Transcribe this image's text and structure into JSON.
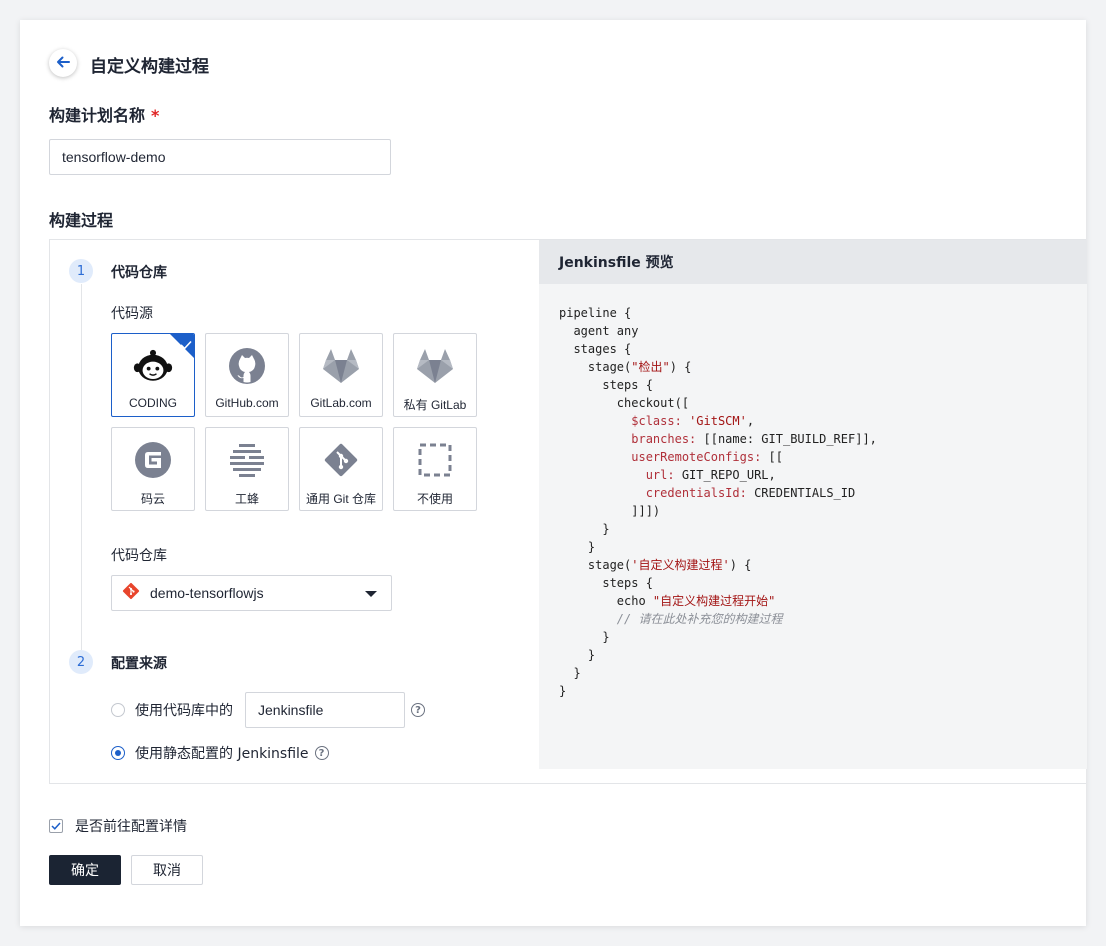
{
  "header": {
    "title": "自定义构建过程"
  },
  "plan_name": {
    "label": "构建计划名称",
    "required_mark": "*",
    "value": "tensorflow-demo"
  },
  "process": {
    "label": "构建过程"
  },
  "step1": {
    "number": "1",
    "title": "代码仓库",
    "source_label": "代码源",
    "sources": [
      {
        "name": "CODING",
        "icon": "coding-icon",
        "selected": true
      },
      {
        "name": "GitHub.com",
        "icon": "github-icon"
      },
      {
        "name": "GitLab.com",
        "icon": "gitlab-icon"
      },
      {
        "name": "私有 GitLab",
        "icon": "gitlab-icon"
      },
      {
        "name": "码云",
        "icon": "gitee-icon"
      },
      {
        "name": "工蜂",
        "icon": "gongfeng-icon"
      },
      {
        "name": "通用 Git 仓库",
        "icon": "git-icon"
      },
      {
        "name": "不使用",
        "icon": "dashed-box-icon"
      }
    ],
    "repo_label": "代码仓库",
    "repo_value": "demo-tensorflowjs"
  },
  "step2": {
    "number": "2",
    "title": "配置来源",
    "option1": {
      "label": "使用代码库中的",
      "input_value": "Jenkinsfile",
      "selected": false
    },
    "option2": {
      "label": "使用静态配置的 Jenkinsfile",
      "selected": true
    },
    "help_glyph": "?"
  },
  "preview": {
    "title": "Jenkinsfile 预览",
    "lines": [
      [
        [
          "t",
          "pipeline {"
        ]
      ],
      [
        [
          "t",
          "  agent any"
        ]
      ],
      [
        [
          "t",
          "  stages {"
        ]
      ],
      [
        [
          "t",
          "    stage("
        ],
        [
          "s",
          "\"检出\""
        ],
        [
          "t",
          ") {"
        ]
      ],
      [
        [
          "t",
          "      steps {"
        ]
      ],
      [
        [
          "t",
          "        checkout(["
        ]
      ],
      [
        [
          "t",
          "          "
        ],
        [
          "k",
          "$class:"
        ],
        [
          "t",
          " "
        ],
        [
          "s",
          "'GitSCM'"
        ],
        [
          "t",
          ","
        ]
      ],
      [
        [
          "t",
          "          "
        ],
        [
          "k",
          "branches:"
        ],
        [
          "t",
          " [[name: GIT_BUILD_REF]],"
        ]
      ],
      [
        [
          "t",
          "          "
        ],
        [
          "k",
          "userRemoteConfigs:"
        ],
        [
          "t",
          " [["
        ]
      ],
      [
        [
          "t",
          "            "
        ],
        [
          "k",
          "url:"
        ],
        [
          "t",
          " GIT_REPO_URL,"
        ]
      ],
      [
        [
          "t",
          "            "
        ],
        [
          "k",
          "credentialsId:"
        ],
        [
          "t",
          " CREDENTIALS_ID"
        ]
      ],
      [
        [
          "t",
          "          ]]])"
        ]
      ],
      [
        [
          "t",
          "      }"
        ]
      ],
      [
        [
          "t",
          "    }"
        ]
      ],
      [
        [
          "t",
          "    stage("
        ],
        [
          "s",
          "'自定义构建过程'"
        ],
        [
          "t",
          ") {"
        ]
      ],
      [
        [
          "t",
          "      steps {"
        ]
      ],
      [
        [
          "t",
          "        echo "
        ],
        [
          "s",
          "\"自定义构建过程开始\""
        ]
      ],
      [
        [
          "c",
          "        // 请在此处补充您的构建过程"
        ]
      ],
      [
        [
          "t",
          "      }"
        ]
      ],
      [
        [
          "t",
          "    }"
        ]
      ],
      [
        [
          "t",
          "  }"
        ]
      ],
      [
        [
          "t",
          "}"
        ]
      ]
    ]
  },
  "footer": {
    "checkbox_label": "是否前往配置详情",
    "checkbox_checked": true,
    "confirm_label": "确定",
    "cancel_label": "取消"
  },
  "colors": {
    "accent": "#1c5fc9",
    "primary_button": "#1b2433",
    "required": "#e02424"
  }
}
